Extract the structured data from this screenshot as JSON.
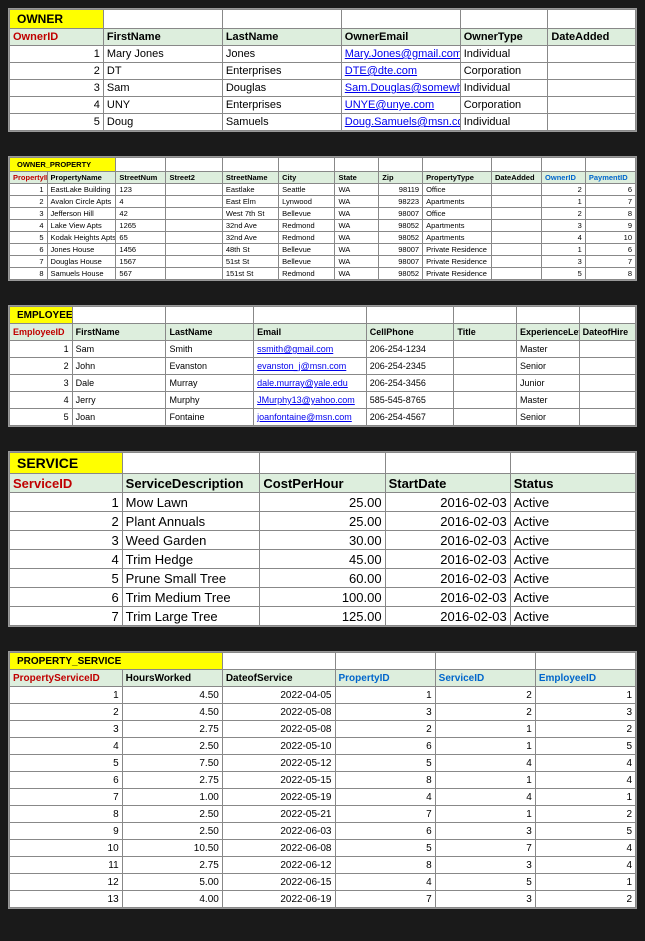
{
  "owner": {
    "title": "OWNER",
    "headers": [
      "OwnerID",
      "FirstName",
      "LastName",
      "OwnerEmail",
      "OwnerType",
      "DateAdded"
    ],
    "pkCol": 0,
    "rows": [
      [
        "1",
        "Mary Jones",
        "Jones",
        "Mary.Jones@gmail.com",
        "Individual",
        ""
      ],
      [
        "2",
        "DT",
        "Enterprises",
        "DTE@dte.com",
        "Corporation",
        ""
      ],
      [
        "3",
        "Sam",
        "Douglas",
        "Sam.Douglas@somewher",
        "Individual",
        ""
      ],
      [
        "4",
        "UNY",
        "Enterprises",
        "UNYE@unye.com",
        "Corporation",
        ""
      ],
      [
        "5",
        "Doug",
        "Samuels",
        "Doug.Samuels@msn.com",
        "Individual",
        ""
      ]
    ]
  },
  "owner_property": {
    "title": "OWNER_PROPERTY",
    "headers": [
      "PropertyID",
      "PropertyName",
      "StreetNum",
      "Street2",
      "StreetName",
      "City",
      "State",
      "Zip",
      "PropertyType",
      "DateAdded",
      "OwnerID",
      "PaymentID"
    ],
    "pkCol": 0,
    "fkCols": [
      10,
      11
    ],
    "rows": [
      [
        "1",
        "EastLake Building",
        "123",
        "",
        "Eastlake",
        "Seattle",
        "WA",
        "98119",
        "Office",
        "",
        "2",
        "6"
      ],
      [
        "2",
        "Avalon Circle Apts",
        "4",
        "",
        "East Elm",
        "Lynwood",
        "WA",
        "98223",
        "Apartments",
        "",
        "1",
        "7"
      ],
      [
        "3",
        "Jefferson Hill",
        "42",
        "",
        "West 7th St",
        "Bellevue",
        "WA",
        "98007",
        "Office",
        "",
        "2",
        "8"
      ],
      [
        "4",
        "Lake View Apts",
        "1265",
        "",
        "32nd Ave",
        "Redmond",
        "WA",
        "98052",
        "Apartments",
        "",
        "3",
        "9"
      ],
      [
        "5",
        "Kodak Heights Apts",
        "65",
        "",
        "32nd Ave",
        "Redmond",
        "WA",
        "98052",
        "Apartments",
        "",
        "4",
        "10"
      ],
      [
        "6",
        "Jones House",
        "1456",
        "",
        "48th St",
        "Bellevue",
        "WA",
        "98007",
        "Private Residence",
        "",
        "1",
        "6"
      ],
      [
        "7",
        "Douglas House",
        "1567",
        "",
        "51st St",
        "Bellevue",
        "WA",
        "98007",
        "Private Residence",
        "",
        "3",
        "7"
      ],
      [
        "8",
        "Samuels House",
        "567",
        "",
        "151st St",
        "Redmond",
        "WA",
        "98052",
        "Private Residence",
        "",
        "5",
        "8"
      ]
    ]
  },
  "employee": {
    "title": "EMPLOYEE",
    "headers": [
      "EmployeeID",
      "FirstName",
      "LastName",
      "Email",
      "CellPhone",
      "Title",
      "ExperienceLevel",
      "DateofHire"
    ],
    "pkCol": 0,
    "rows": [
      [
        "1",
        "Sam",
        "Smith",
        "ssmith@gmail.com",
        "206-254-1234",
        "",
        "Master",
        ""
      ],
      [
        "2",
        "John",
        "Evanston",
        "evanston_j@msn.com",
        "206-254-2345",
        "",
        "Senior",
        ""
      ],
      [
        "3",
        "Dale",
        "Murray",
        "dale.murray@yale.edu",
        "206-254-3456",
        "",
        "Junior",
        ""
      ],
      [
        "4",
        "Jerry",
        "Murphy",
        "JMurphy13@yahoo.com",
        "585-545-8765",
        "",
        "Master",
        ""
      ],
      [
        "5",
        "Joan",
        "Fontaine",
        "joanfontaine@msn.com",
        "206-254-4567",
        "",
        "Senior",
        ""
      ]
    ]
  },
  "service": {
    "title": "SERVICE",
    "headers": [
      "ServiceID",
      "ServiceDescription",
      "CostPerHour",
      "StartDate",
      "Status"
    ],
    "pkCol": 0,
    "rows": [
      [
        "1",
        "Mow Lawn",
        "25.00",
        "2016-02-03",
        "Active"
      ],
      [
        "2",
        "Plant Annuals",
        "25.00",
        "2016-02-03",
        "Active"
      ],
      [
        "3",
        "Weed Garden",
        "30.00",
        "2016-02-03",
        "Active"
      ],
      [
        "4",
        "Trim Hedge",
        "45.00",
        "2016-02-03",
        "Active"
      ],
      [
        "5",
        "Prune Small Tree",
        "60.00",
        "2016-02-03",
        "Active"
      ],
      [
        "6",
        "Trim Medium Tree",
        "100.00",
        "2016-02-03",
        "Active"
      ],
      [
        "7",
        "Trim Large Tree",
        "125.00",
        "2016-02-03",
        "Active"
      ]
    ]
  },
  "property_service": {
    "title": "PROPERTY_SERVICE",
    "headers": [
      "PropertyServiceID",
      "HoursWorked",
      "DateofService",
      "PropertyID",
      "ServiceID",
      "EmployeeID"
    ],
    "pkCol": 0,
    "fkCols": [
      3,
      4,
      5
    ],
    "rows": [
      [
        "1",
        "4.50",
        "2022-04-05",
        "1",
        "2",
        "1"
      ],
      [
        "2",
        "4.50",
        "2022-05-08",
        "3",
        "2",
        "3"
      ],
      [
        "3",
        "2.75",
        "2022-05-08",
        "2",
        "1",
        "2"
      ],
      [
        "4",
        "2.50",
        "2022-05-10",
        "6",
        "1",
        "5"
      ],
      [
        "5",
        "7.50",
        "2022-05-12",
        "5",
        "4",
        "4"
      ],
      [
        "6",
        "2.75",
        "2022-05-15",
        "8",
        "1",
        "4"
      ],
      [
        "7",
        "1.00",
        "2022-05-19",
        "4",
        "4",
        "1"
      ],
      [
        "8",
        "2.50",
        "2022-05-21",
        "7",
        "1",
        "2"
      ],
      [
        "9",
        "2.50",
        "2022-06-03",
        "6",
        "3",
        "5"
      ],
      [
        "10",
        "10.50",
        "2022-06-08",
        "5",
        "7",
        "4"
      ],
      [
        "11",
        "2.75",
        "2022-06-12",
        "8",
        "3",
        "4"
      ],
      [
        "12",
        "5.00",
        "2022-06-15",
        "4",
        "5",
        "1"
      ],
      [
        "13",
        "4.00",
        "2022-06-19",
        "7",
        "3",
        "2"
      ]
    ]
  }
}
